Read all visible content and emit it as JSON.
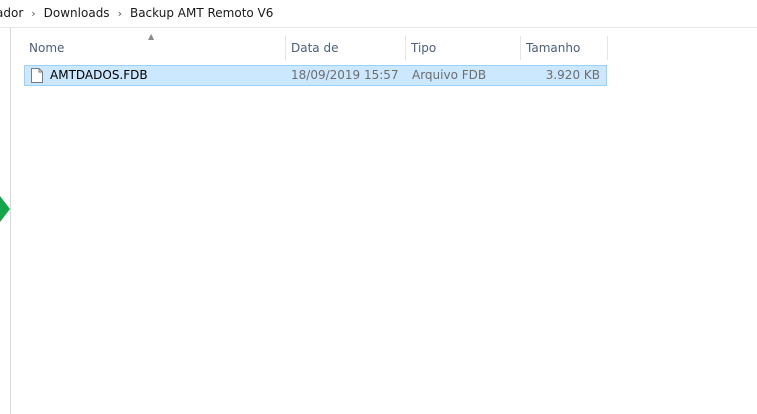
{
  "breadcrumb": [
    "ador",
    "Downloads",
    "Backup AMT Remoto V6"
  ],
  "breadcrumb_separator": "›",
  "columns": {
    "name": "Nome",
    "date": "Data de modificaç...",
    "type": "Tipo",
    "size": "Tamanho"
  },
  "sort_indicator": "▲",
  "files": [
    {
      "name": "AMTDADOS.FDB",
      "date": "18/09/2019 15:57",
      "type": "Arquivo FDB",
      "size": "3.920 KB",
      "icon": "file-icon",
      "selected": true
    }
  ],
  "colors": {
    "selection_bg": "#cce8ff",
    "selection_border": "#99d1ff",
    "header_text": "#4c607a",
    "marker": "#13a64b"
  }
}
